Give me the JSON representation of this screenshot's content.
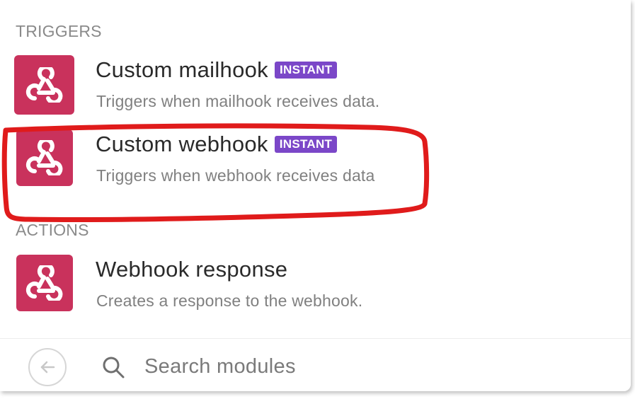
{
  "sections": {
    "triggers_title": "TRIGGERS",
    "actions_title": "ACTIONS"
  },
  "modules": {
    "custom_mailhook": {
      "name": "Custom mailhook",
      "badge": "INSTANT",
      "description": "Triggers when mailhook receives data.",
      "icon": "webhook-icon"
    },
    "custom_webhook": {
      "name": "Custom webhook",
      "badge": "INSTANT",
      "description": "Triggers when webhook receives data",
      "icon": "webhook-icon"
    },
    "webhook_response": {
      "name": "Webhook response",
      "description": "Creates a response to the webhook.",
      "icon": "webhook-icon"
    }
  },
  "footer": {
    "back_icon": "arrow-left-circle-icon",
    "search_icon": "search-icon",
    "search_placeholder": "Search modules",
    "search_value": ""
  },
  "colors": {
    "icon_background": "#c9325c",
    "badge_background": "#7b47c8",
    "highlight_annotation": "#e01b1b"
  }
}
